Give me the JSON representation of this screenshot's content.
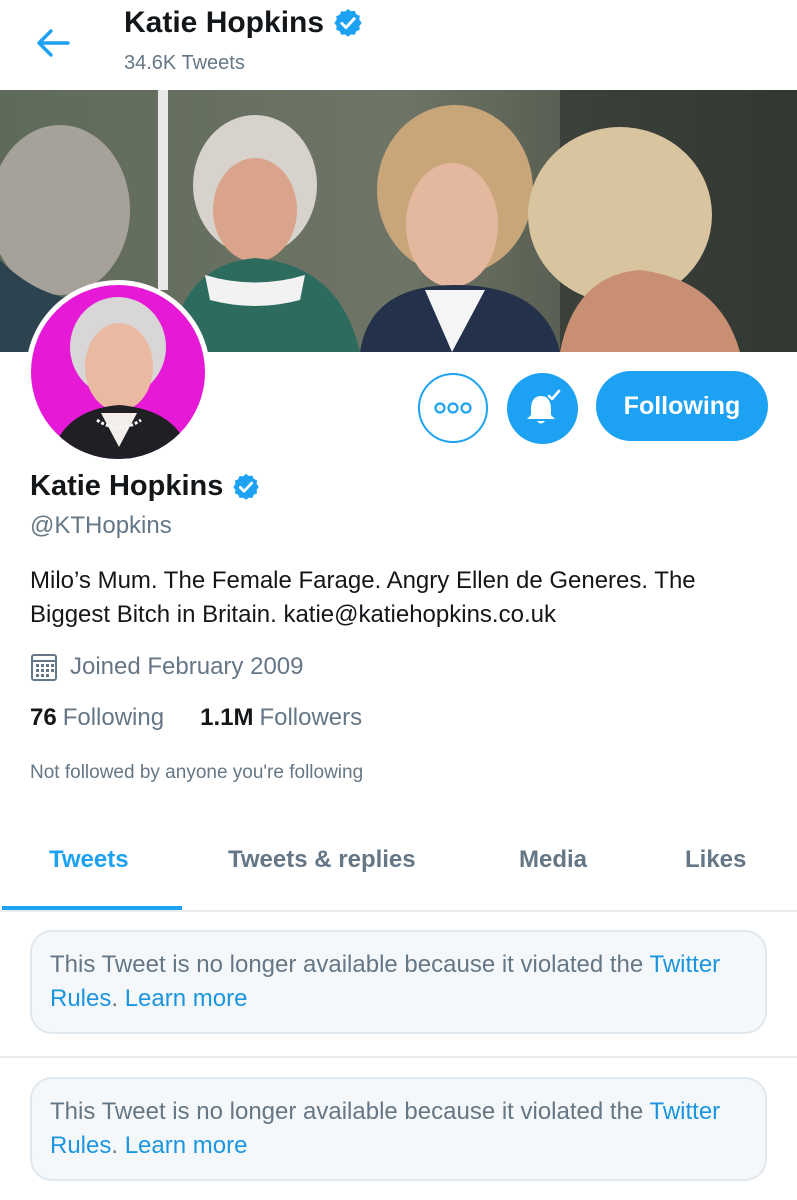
{
  "header": {
    "name": "Katie Hopkins",
    "tweet_count": "34.6K Tweets"
  },
  "profile": {
    "display_name": "Katie Hopkins",
    "handle": "@KTHopkins",
    "bio_text": "Milo’s Mum. The Female Farage. Angry Ellen de Generes. The Biggest Bitch in Britain. ",
    "bio_email": "katie@katiehopkins.co.uk",
    "joined": "Joined February 2009",
    "following_count": "76",
    "following_label": "Following",
    "followers_count": "1.1M",
    "followers_label": "Followers",
    "mutuals_note": "Not followed by anyone you're following"
  },
  "actions": {
    "following_label": "Following"
  },
  "tabs": [
    {
      "label": "Tweets",
      "active": true
    },
    {
      "label": "Tweets & replies",
      "active": false
    },
    {
      "label": "Media",
      "active": false
    },
    {
      "label": "Likes",
      "active": false
    }
  ],
  "tweets": [
    {
      "text": "This Tweet is no longer available because it violated the ",
      "link": "Twitter Rules",
      "sep": ". ",
      "learn": "Learn more"
    },
    {
      "text": "This Tweet is no longer available because it violated the ",
      "link": "Twitter Rules",
      "sep": ". ",
      "learn": "Learn more"
    }
  ],
  "icons": {
    "back": "arrow-left-icon",
    "verified": "verified-badge-icon",
    "more": "more-icon",
    "notify": "bell-icon",
    "calendar": "calendar-icon"
  },
  "colors": {
    "accent": "#1da1f2",
    "text": "#14171a",
    "secondary": "#657786",
    "avatar_bg": "#e619d6"
  }
}
